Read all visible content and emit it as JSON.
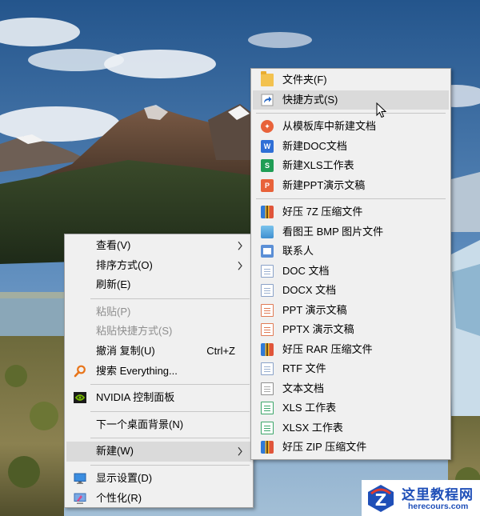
{
  "main_menu": {
    "items": [
      {
        "label": "查看(V)",
        "submenu": true
      },
      {
        "label": "排序方式(O)",
        "submenu": true
      },
      {
        "label": "刷新(E)"
      },
      {
        "label": "粘贴(P)",
        "disabled": true
      },
      {
        "label": "粘贴快捷方式(S)",
        "disabled": true
      },
      {
        "label": "撤消 复制(U)",
        "shortcut": "Ctrl+Z"
      },
      {
        "label": "搜索 Everything...",
        "icon": "magnifier-icon"
      },
      {
        "label": "NVIDIA 控制面板",
        "icon": "nvidia-icon"
      },
      {
        "label": "下一个桌面背景(N)"
      },
      {
        "label": "新建(W)",
        "submenu": true,
        "highlighted": true
      },
      {
        "label": "显示设置(D)",
        "icon": "display-settings-icon"
      },
      {
        "label": "个性化(R)",
        "icon": "personalize-icon"
      }
    ]
  },
  "sub_menu": {
    "items": [
      {
        "label": "文件夹(F)",
        "icon": "folder-icon"
      },
      {
        "label": "快捷方式(S)",
        "icon": "shortcut-icon",
        "highlighted": true
      },
      {
        "label": "从模板库中新建文档",
        "icon": "template-icon"
      },
      {
        "label": "新建DOC文档",
        "icon": "wps-doc-icon"
      },
      {
        "label": "新建XLS工作表",
        "icon": "wps-xls-icon"
      },
      {
        "label": "新建PPT演示文稿",
        "icon": "wps-ppt-icon"
      },
      {
        "label": "好压 7Z 压缩文件",
        "icon": "haozip-icon"
      },
      {
        "label": "看图王 BMP 图片文件",
        "icon": "bmp-image-icon"
      },
      {
        "label": "联系人",
        "icon": "contact-icon"
      },
      {
        "label": "DOC 文档",
        "icon": "doc-file-icon"
      },
      {
        "label": "DOCX 文档",
        "icon": "docx-file-icon"
      },
      {
        "label": "PPT 演示文稿",
        "icon": "ppt-file-icon"
      },
      {
        "label": "PPTX 演示文稿",
        "icon": "pptx-file-icon"
      },
      {
        "label": "好压 RAR 压缩文件",
        "icon": "haozip-icon"
      },
      {
        "label": "RTF 文件",
        "icon": "rtf-file-icon"
      },
      {
        "label": "文本文档",
        "icon": "text-file-icon"
      },
      {
        "label": "XLS 工作表",
        "icon": "xls-file-icon"
      },
      {
        "label": "XLSX 工作表",
        "icon": "xlsx-file-icon"
      },
      {
        "label": "好压 ZIP 压缩文件",
        "icon": "haozip-icon"
      }
    ]
  },
  "watermark": {
    "title": "这里教程网",
    "url": "herecours.com",
    "logo_letter": "Z"
  },
  "colors": {
    "menu_bg": "#f0f0f0",
    "highlight": "#dadada",
    "disabled_text": "#8e8e8e",
    "watermark_blue": "#1f4fb8"
  }
}
